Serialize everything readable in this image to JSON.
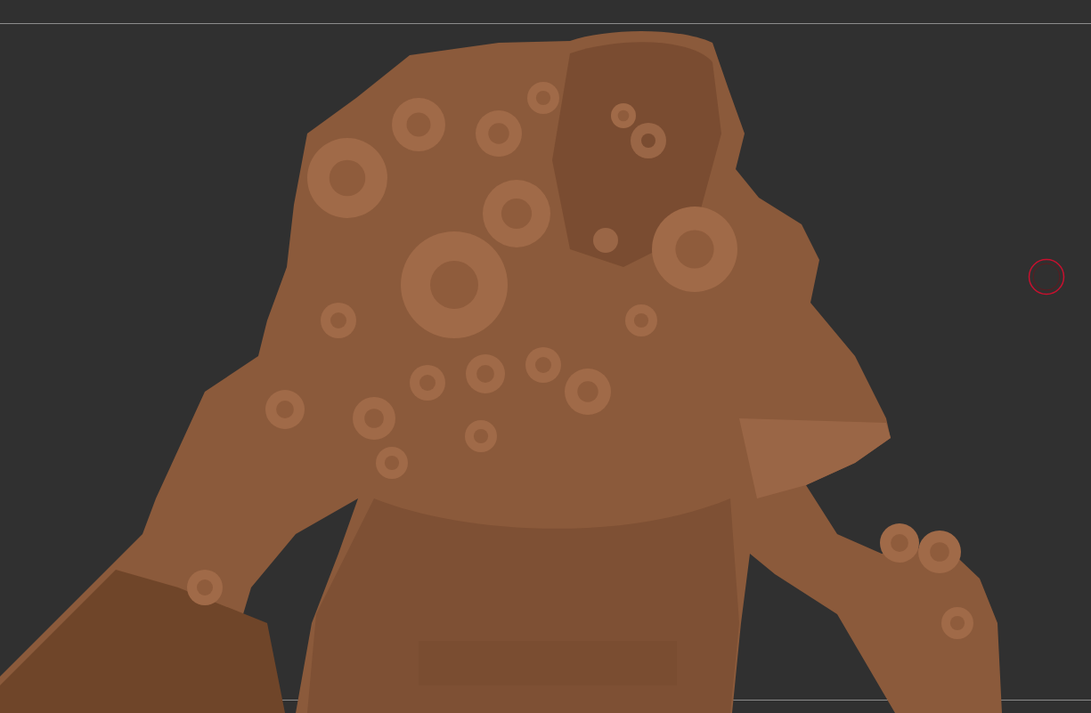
{
  "viewport": {
    "brush_cursor": true
  }
}
